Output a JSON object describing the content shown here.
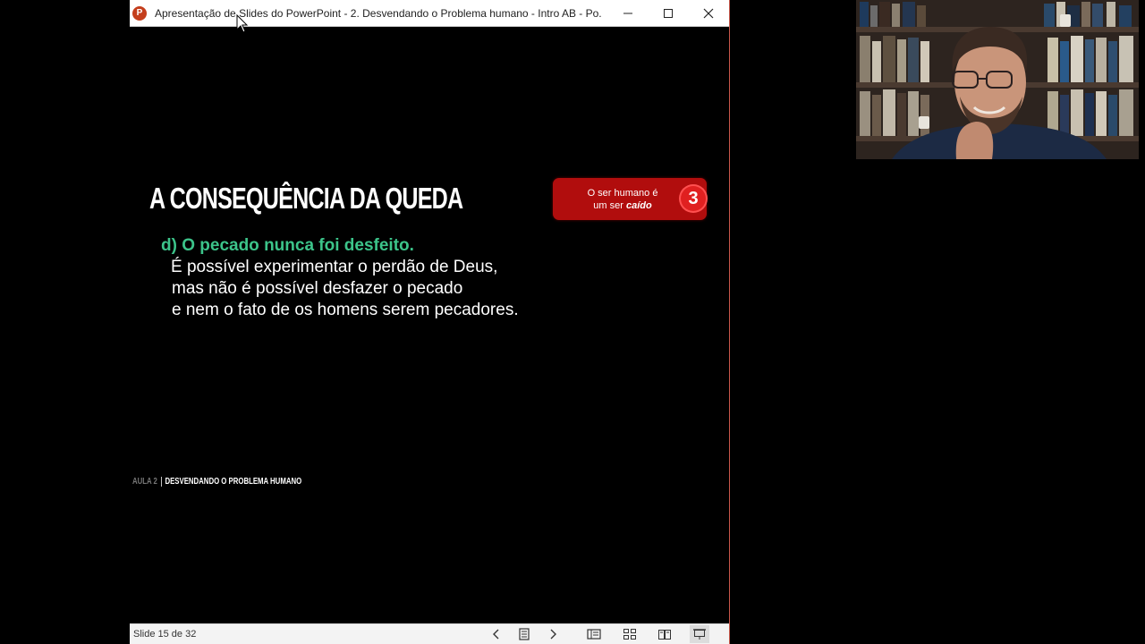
{
  "window": {
    "title": "Apresentação de Slides do PowerPoint  -  2. Desvendando o Problema humano - Intro AB - Po...",
    "app_icon_letter": "P"
  },
  "slide": {
    "heading": "A CONSEQUÊNCIA DA QUEDA",
    "badge": {
      "line1": "O ser humano é",
      "line2_prefix": "um ser ",
      "line2_emphasis": "caído",
      "number": "3"
    },
    "point_heading": "d) O pecado nunca foi desfeito.",
    "body_lines": [
      "É possível experimentar o perdão de Deus,",
      "mas não é possível desfazer o pecado",
      "e nem o fato de os homens serem pecadores."
    ],
    "footer": {
      "aula": "AULA 2",
      "topic": "DESVENDANDO O PROBLEMA HUMANO"
    }
  },
  "statusbar": {
    "slide_counter": "Slide 15 de 32"
  },
  "colors": {
    "accent_green": "#3cc48a",
    "badge_red": "#b10d0d",
    "ppt_orange": "#c43e1c"
  }
}
